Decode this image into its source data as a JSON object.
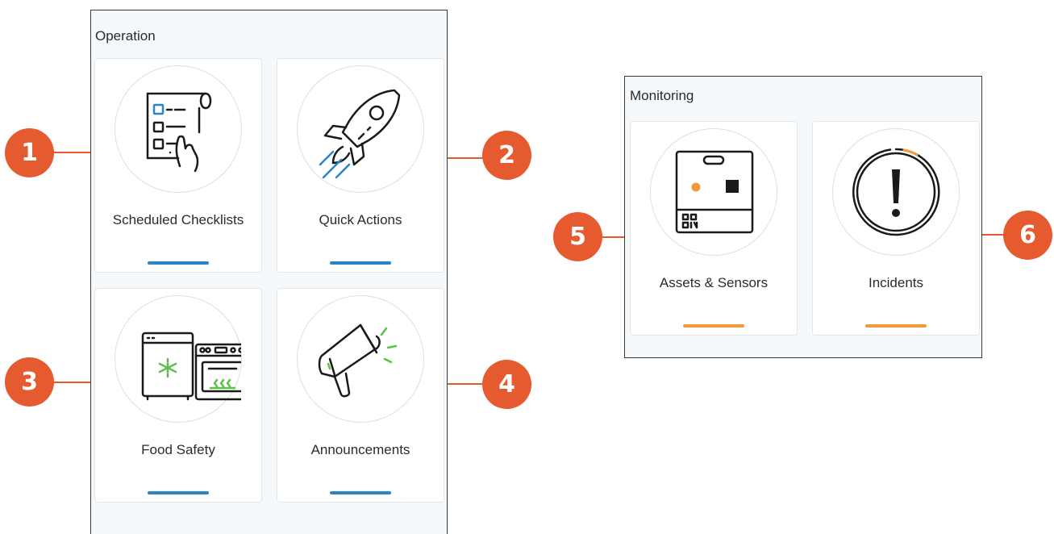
{
  "operation": {
    "title": "Operation",
    "tiles": [
      {
        "label": "Scheduled Checklists",
        "icon": "checklist-icon",
        "marker": "1"
      },
      {
        "label": "Quick Actions",
        "icon": "rocket-icon",
        "marker": "2"
      },
      {
        "label": "Food Safety",
        "icon": "fridge-oven-icon",
        "marker": "3"
      },
      {
        "label": "Announcements",
        "icon": "megaphone-icon",
        "marker": "4"
      }
    ]
  },
  "monitoring": {
    "title": "Monitoring",
    "tiles": [
      {
        "label": "Assets & Sensors",
        "icon": "sensor-device-icon",
        "marker": "5"
      },
      {
        "label": "Incidents",
        "icon": "alert-icon",
        "marker": "6"
      }
    ]
  },
  "colors": {
    "marker": "#e55a2e",
    "operation_accent": "#2b84c6",
    "monitoring_accent": "#f29a38",
    "icon_line": "#1a1a1a",
    "icon_green": "#5cc04a"
  }
}
